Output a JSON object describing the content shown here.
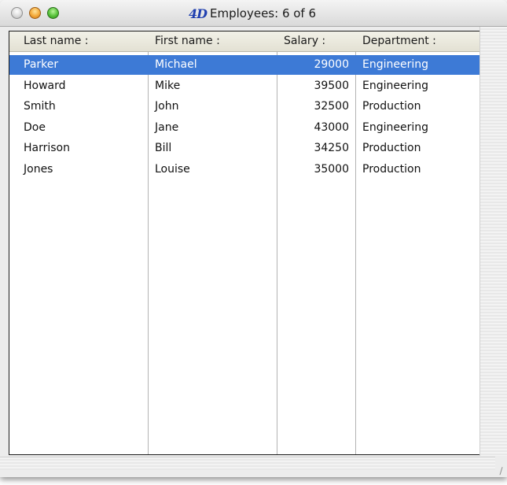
{
  "window": {
    "title_logo": "4D",
    "title": "Employees: 6 of 6"
  },
  "table": {
    "columns": [
      {
        "label": "Last name :"
      },
      {
        "label": "First name :"
      },
      {
        "label": "Salary :"
      },
      {
        "label": "Department :"
      }
    ],
    "rows": [
      {
        "last": "Parker",
        "first": "Michael",
        "salary": "29000",
        "department": "Engineering",
        "selected": true
      },
      {
        "last": "Howard",
        "first": "Mike",
        "salary": "39500",
        "department": "Engineering",
        "selected": false
      },
      {
        "last": "Smith",
        "first": "John",
        "salary": "32500",
        "department": "Production",
        "selected": false
      },
      {
        "last": "Doe",
        "first": "Jane",
        "salary": "43000",
        "department": "Engineering",
        "selected": false
      },
      {
        "last": "Harrison",
        "first": "Bill",
        "salary": "34250",
        "department": "Production",
        "selected": false
      },
      {
        "last": "Jones",
        "first": "Louise",
        "salary": "35000",
        "department": "Production",
        "selected": false
      }
    ]
  },
  "colors": {
    "selection": "#3d7ad6",
    "header_bg": "#ebe9dd"
  },
  "icons": {
    "close": "close-button-icon",
    "minimize": "minimize-button-icon",
    "zoom": "zoom-button-icon",
    "resize": "resize-grip-icon"
  }
}
